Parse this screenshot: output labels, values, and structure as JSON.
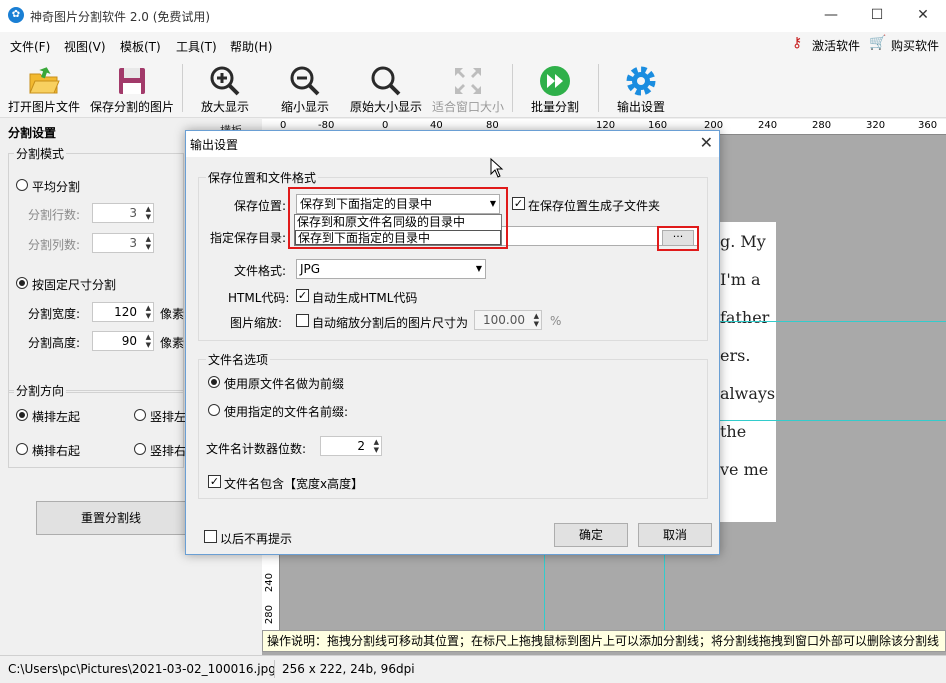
{
  "window": {
    "title": "神奇图片分割软件 2.0 (免费试用)",
    "min": "—",
    "max": "☐",
    "close": "✕"
  },
  "menu": {
    "items": [
      "文件(F)",
      "视图(V)",
      "模板(T)",
      "工具(T)",
      "帮助(H)"
    ],
    "activate": "激活软件",
    "buy": "购买软件"
  },
  "toolbar": {
    "open": "打开图片文件",
    "save": "保存分割的图片",
    "zoom_in": "放大显示",
    "zoom_out": "缩小显示",
    "original": "原始大小显示",
    "fit": "适合窗口大小",
    "batch": "批量分割",
    "output": "输出设置"
  },
  "left": {
    "header": "分割设置",
    "mode_group": "分割模式",
    "even": "平均分割",
    "rows_label": "分割行数:",
    "rows": "3",
    "cols_label": "分割列数:",
    "cols": "3",
    "fixed": "按固定尺寸分割",
    "width_label": "分割宽度:",
    "width": "120",
    "height_label": "分割高度:",
    "height": "90",
    "unit": "像素",
    "dir_group": "分割方向",
    "h_left": "横排左起",
    "v_left": "竖排左",
    "h_right": "横排右起",
    "v_right": "竖排右",
    "reset": "重置分割线"
  },
  "ruler": {
    "partial_label": "横板",
    "h_ticks": [
      "0",
      "-80",
      "0",
      "40",
      "80",
      "120",
      "160",
      "200",
      "240",
      "280",
      "320",
      "360"
    ],
    "v_ticks": [
      "240",
      "280"
    ]
  },
  "doc_lines": [
    "g. My",
    "I'm a",
    "father",
    "ers.",
    "always",
    "the",
    "ve me"
  ],
  "hint": "操作说明：拖拽分割线可移动其位置；在标尺上拖拽鼠标到图片上可以添加分割线；将分割线拖拽到窗口外部可以删除该分割线",
  "status": {
    "path": "C:\\Users\\pc\\Pictures\\2021-03-02_100016.jpg",
    "info": "256 x 222, 24b, 96dpi"
  },
  "dialog": {
    "title": "输出设置",
    "close": "✕",
    "section1": "保存位置和文件格式",
    "save_loc_label": "保存位置:",
    "save_loc_value": "保存到下面指定的目录中",
    "dropdown_options": [
      "保存到和原文件名同级的目录中",
      "保存到下面指定的目录中"
    ],
    "subfolder_label": "在保存位置生成子文件夹",
    "dir_label": "指定保存目录:",
    "browse": "···",
    "format_label": "文件格式:",
    "format_value": "JPG",
    "html_label": "HTML代码:",
    "html_check": "自动生成HTML代码",
    "scale_label": "图片缩放:",
    "scale_check": "自动缩放分割后的图片尺寸为",
    "scale_value": "100.00",
    "scale_unit": "%",
    "section2": "文件名选项",
    "use_orig": "使用原文件名做为前缀",
    "use_custom": "使用指定的文件名前缀:",
    "counter_label": "文件名计数器位数:",
    "counter_value": "2",
    "include_size": "文件名包含【宽度x高度】",
    "no_prompt": "以后不再提示",
    "ok": "确定",
    "cancel": "取消"
  },
  "colors": {
    "accent": "#1a7fd4",
    "highlight_box": "#e01a1a",
    "guide": "#33cccc"
  }
}
